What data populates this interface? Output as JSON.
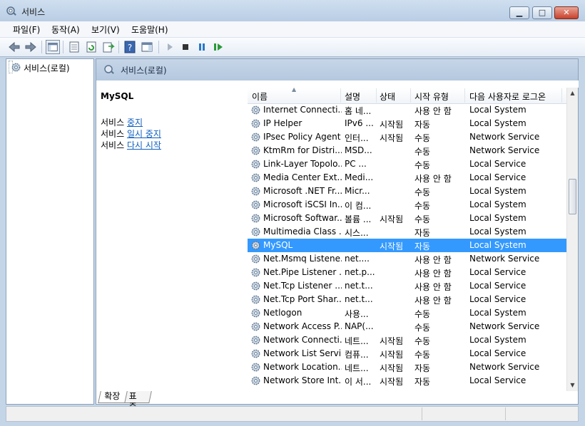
{
  "window": {
    "title": "서비스",
    "min_glyph": "▁",
    "max_glyph": "□",
    "close_glyph": "✕"
  },
  "menu": [
    "파일(F)",
    "동작(A)",
    "보기(V)",
    "도움말(H)"
  ],
  "tree": {
    "root_label": "서비스(로컬)"
  },
  "header": {
    "title": "서비스(로컬)"
  },
  "detail": {
    "service_name": "MySQL",
    "actions": [
      {
        "prefix": "서비스",
        "link": "중지"
      },
      {
        "prefix": "서비스",
        "link": "일시 중지"
      },
      {
        "prefix": "서비스",
        "link": "다시 시작"
      }
    ]
  },
  "columns": [
    "이름",
    "설명",
    "상태",
    "시작 유형",
    "다음 사용자로 로그온"
  ],
  "rows": [
    [
      "Internet Connecti...",
      "홈 네...",
      "",
      "사용 안 함",
      "Local System"
    ],
    [
      "IP Helper",
      "IPv6 ...",
      "시작됨",
      "자동",
      "Local System"
    ],
    [
      "IPsec Policy Agent",
      "인터...",
      "시작됨",
      "수동",
      "Network Service"
    ],
    [
      "KtmRm for Distri...",
      "MSD...",
      "",
      "수동",
      "Network Service"
    ],
    [
      "Link-Layer Topolo...",
      "PC ...",
      "",
      "수동",
      "Local Service"
    ],
    [
      "Media Center Ext...",
      "Medi...",
      "",
      "사용 안 함",
      "Local Service"
    ],
    [
      "Microsoft .NET Fr...",
      "Micr...",
      "",
      "수동",
      "Local System"
    ],
    [
      "Microsoft iSCSI In...",
      "이 컴...",
      "",
      "수동",
      "Local System"
    ],
    [
      "Microsoft Softwar...",
      "볼륨 ...",
      "시작됨",
      "수동",
      "Local System"
    ],
    [
      "Multimedia Class ...",
      "시스...",
      "",
      "자동",
      "Local System"
    ],
    [
      "MySQL",
      "",
      "시작됨",
      "자동",
      "Local System"
    ],
    [
      "Net.Msmq Listene...",
      "net....",
      "",
      "사용 안 함",
      "Network Service"
    ],
    [
      "Net.Pipe Listener ...",
      "net.p...",
      "",
      "사용 안 함",
      "Local Service"
    ],
    [
      "Net.Tcp Listener ...",
      "net.t...",
      "",
      "사용 안 함",
      "Local Service"
    ],
    [
      "Net.Tcp Port Shar...",
      "net.t...",
      "",
      "사용 안 함",
      "Local Service"
    ],
    [
      "Netlogon",
      "사용...",
      "",
      "수동",
      "Local System"
    ],
    [
      "Network Access P...",
      "NAP(...",
      "",
      "수동",
      "Network Service"
    ],
    [
      "Network Connecti...",
      "네트...",
      "시작됨",
      "수동",
      "Local System"
    ],
    [
      "Network List Servi...",
      "컴퓨...",
      "시작됨",
      "수동",
      "Local Service"
    ],
    [
      "Network Location...",
      "네트...",
      "시작됨",
      "자동",
      "Network Service"
    ],
    [
      "Network Store Int...",
      "이 서...",
      "시작됨",
      "자동",
      "Local Service"
    ]
  ],
  "selected_row": 10,
  "tabs": [
    "확장",
    "표준"
  ],
  "scroll": {
    "up": "▲",
    "down": "▼"
  },
  "colors": {
    "selection": "#3399ff",
    "link": "#0f5fbf"
  }
}
